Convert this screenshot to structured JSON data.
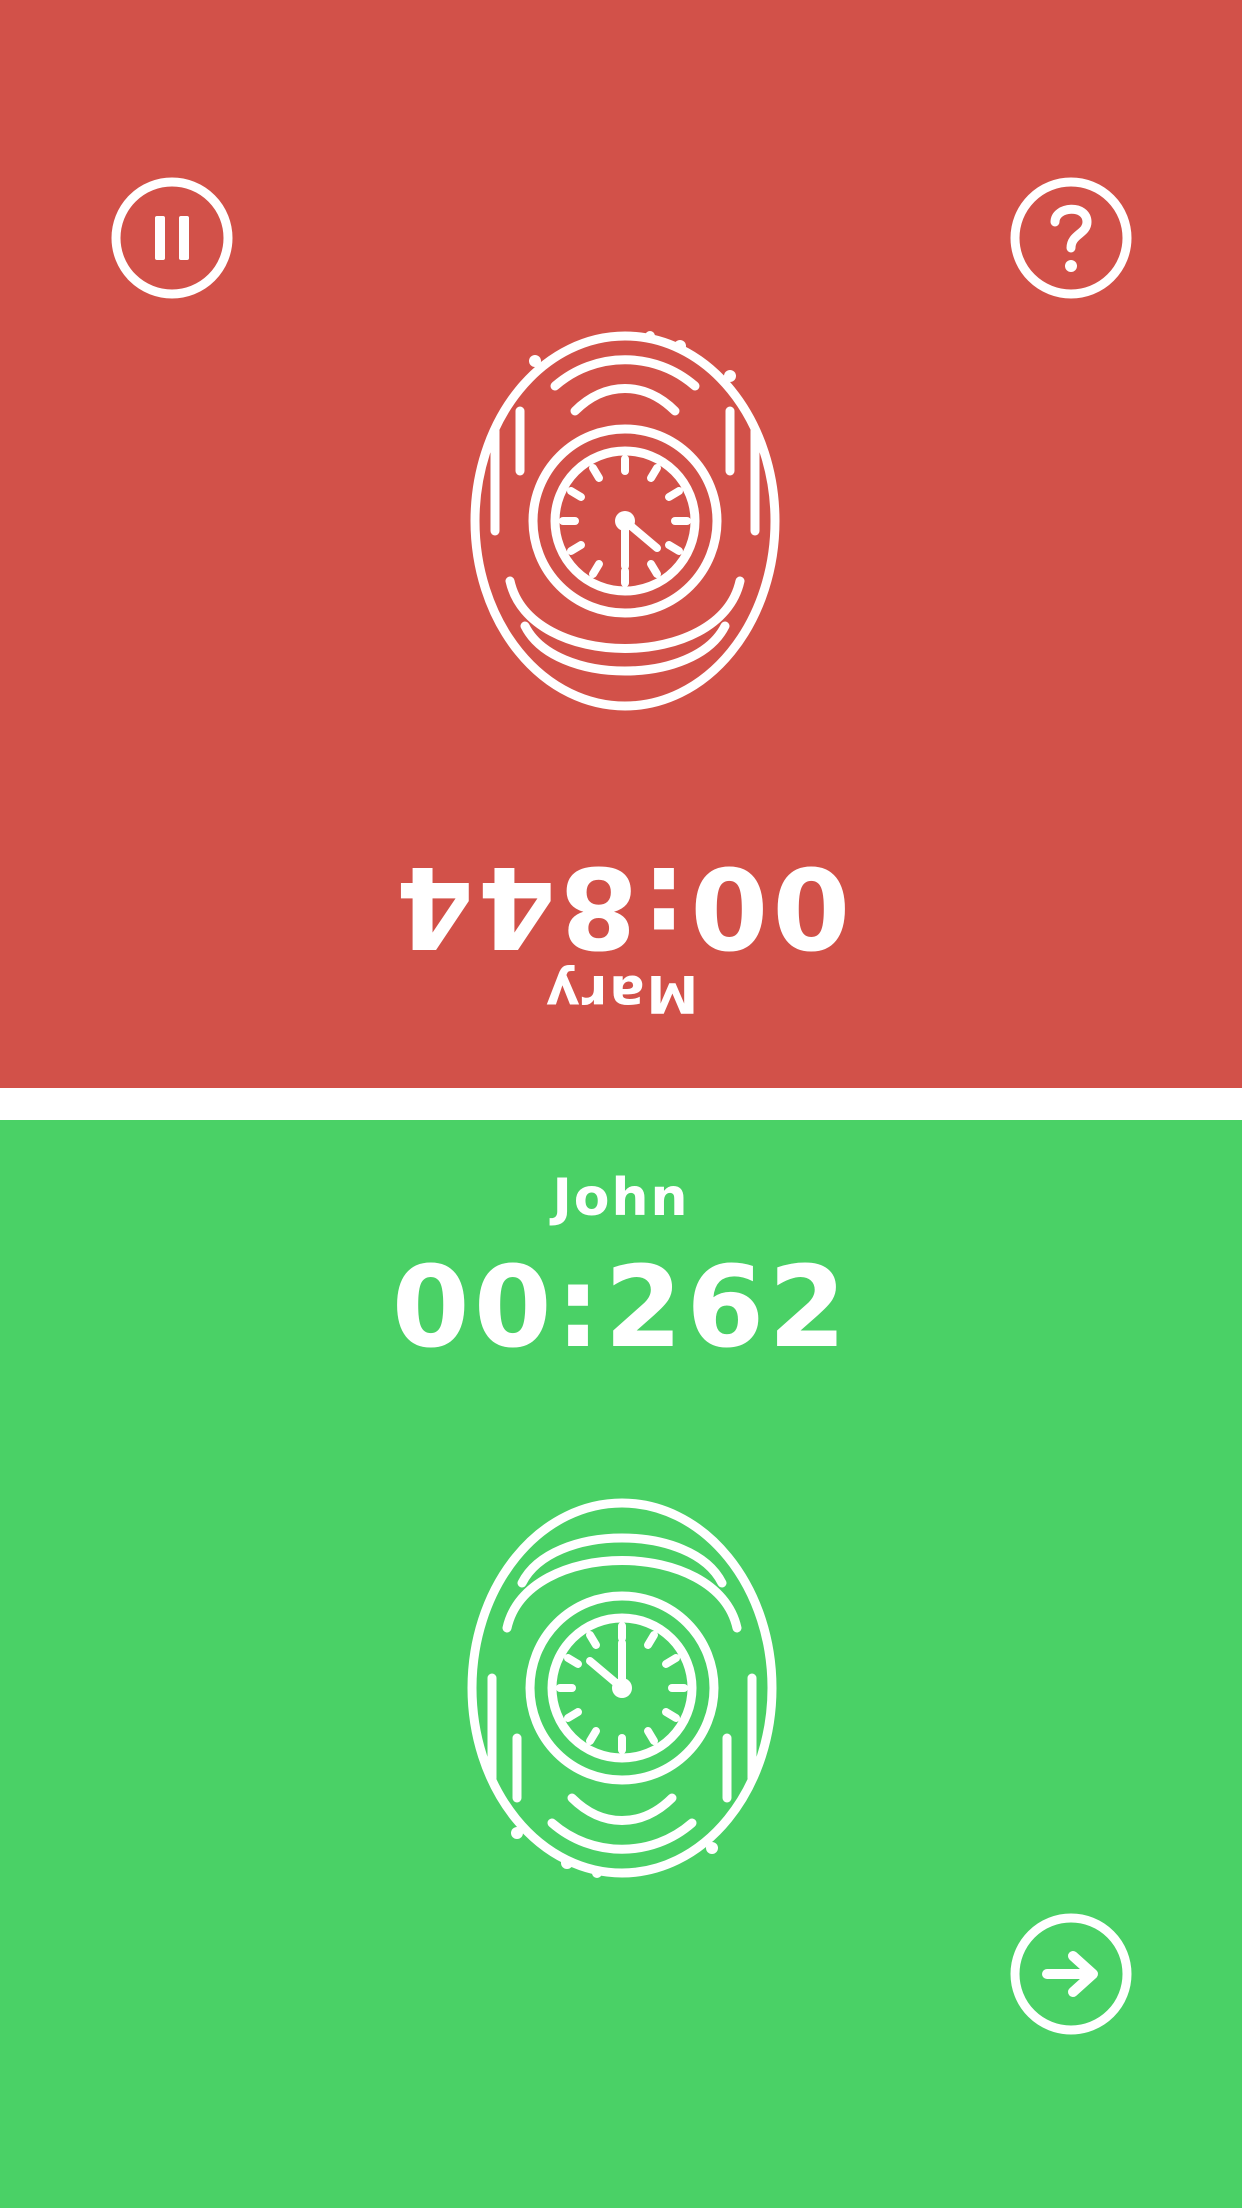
{
  "player_top": {
    "name": "Mary",
    "timer": "00:844",
    "color": "#d25149",
    "status": "waiting"
  },
  "player_bottom": {
    "name": "John",
    "timer": "00:262",
    "color": "#4ad166",
    "status": "active"
  },
  "controls": {
    "pause_icon": "pause-icon",
    "help_icon": "question-icon",
    "next_icon": "arrow-right-icon"
  },
  "divider_color": "#ffffff"
}
